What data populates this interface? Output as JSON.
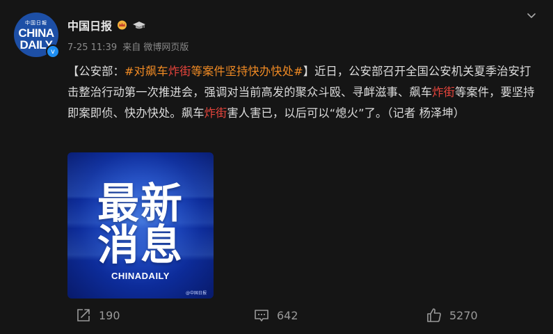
{
  "header": {
    "avatar_small_text": "中国日報",
    "avatar_line1": "CHINA",
    "avatar_line2": "DAILY",
    "verified_mark": "v",
    "author_name": "中国日报",
    "date": "7-25 11:39",
    "source": "来自 微博网页版",
    "icons": [
      "gold-crown-badge-icon",
      "graduation-cap-icon",
      "chevron-down-icon",
      "verified-icon"
    ]
  },
  "post": {
    "bracket_open": "【",
    "prefix": "公安部：",
    "topic_a": "#对飙车",
    "topic_hl": "炸街",
    "topic_b": "等案件坚持快办快处#",
    "bracket_close": "】",
    "body_1": "近日，公安部召开全国公安机关夏季治安打击整治行动第一次推进会，强调对当前高发的聚众斗殴、寻衅滋事、飙车",
    "hl_1": "炸街",
    "body_2": "等案件，要坚持即案即侦、快办快处。飙车",
    "hl_2": "炸街",
    "body_3": "害人害已，以后可以“熄火”了。（记者 杨泽坤）"
  },
  "image": {
    "line1": "最新",
    "line2": "消息",
    "brand": "CHINADAILY",
    "watermark": "@中国日报"
  },
  "actions": {
    "repost_count": "190",
    "comment_count": "642",
    "like_count": "5270"
  },
  "colors": {
    "background": "#151515",
    "topic": "#f08a24",
    "highlight": "#e8453c",
    "avatar_blue": "#1d4fa6"
  }
}
